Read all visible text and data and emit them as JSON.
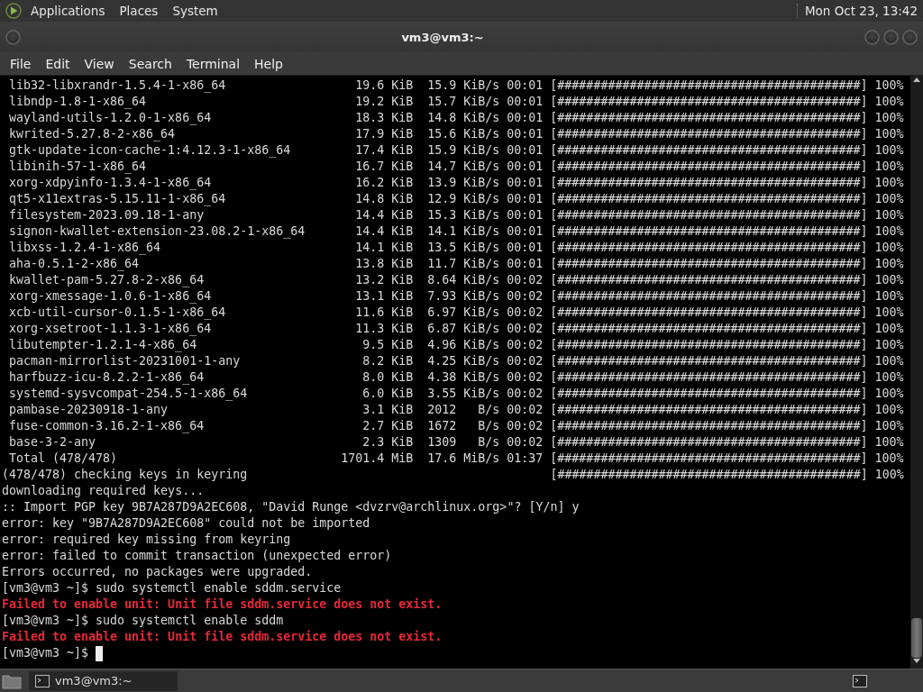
{
  "top_panel": {
    "menus": [
      "Applications",
      "Places",
      "System"
    ],
    "clock": "Mon Oct 23, 13:42"
  },
  "window": {
    "title": "vm3@vm3:~",
    "menu": [
      "File",
      "Edit",
      "View",
      "Search",
      "Terminal",
      "Help"
    ]
  },
  "terminal": {
    "lines": [
      {
        "kind": "transfer",
        "name": "lib32-libxrandr-1.5.4-1-x86_64",
        "size": "19.6 KiB",
        "rate": "15.9 KiB/s",
        "eta": "00:01",
        "bar": "[##########################################]",
        "percent": "100%"
      },
      {
        "kind": "transfer",
        "name": "libndp-1.8-1-x86_64",
        "size": "19.2 KiB",
        "rate": "15.7 KiB/s",
        "eta": "00:01",
        "bar": "[##########################################]",
        "percent": "100%"
      },
      {
        "kind": "transfer",
        "name": "wayland-utils-1.2.0-1-x86_64",
        "size": "18.3 KiB",
        "rate": "14.8 KiB/s",
        "eta": "00:01",
        "bar": "[##########################################]",
        "percent": "100%"
      },
      {
        "kind": "transfer",
        "name": "kwrited-5.27.8-2-x86_64",
        "size": "17.9 KiB",
        "rate": "15.6 KiB/s",
        "eta": "00:01",
        "bar": "[##########################################]",
        "percent": "100%"
      },
      {
        "kind": "transfer",
        "name": "gtk-update-icon-cache-1:4.12.3-1-x86_64",
        "size": "17.4 KiB",
        "rate": "15.9 KiB/s",
        "eta": "00:01",
        "bar": "[##########################################]",
        "percent": "100%"
      },
      {
        "kind": "transfer",
        "name": "libinih-57-1-x86_64",
        "size": "16.7 KiB",
        "rate": "14.7 KiB/s",
        "eta": "00:01",
        "bar": "[##########################################]",
        "percent": "100%"
      },
      {
        "kind": "transfer",
        "name": "xorg-xdpyinfo-1.3.4-1-x86_64",
        "size": "16.2 KiB",
        "rate": "13.9 KiB/s",
        "eta": "00:01",
        "bar": "[##########################################]",
        "percent": "100%"
      },
      {
        "kind": "transfer",
        "name": "qt5-x11extras-5.15.11-1-x86_64",
        "size": "14.8 KiB",
        "rate": "12.9 KiB/s",
        "eta": "00:01",
        "bar": "[##########################################]",
        "percent": "100%"
      },
      {
        "kind": "transfer",
        "name": "filesystem-2023.09.18-1-any",
        "size": "14.4 KiB",
        "rate": "15.3 KiB/s",
        "eta": "00:01",
        "bar": "[##########################################]",
        "percent": "100%"
      },
      {
        "kind": "transfer",
        "name": "signon-kwallet-extension-23.08.2-1-x86_64",
        "size": "14.4 KiB",
        "rate": "14.1 KiB/s",
        "eta": "00:01",
        "bar": "[##########################################]",
        "percent": "100%"
      },
      {
        "kind": "transfer",
        "name": "libxss-1.2.4-1-x86_64",
        "size": "14.1 KiB",
        "rate": "13.5 KiB/s",
        "eta": "00:01",
        "bar": "[##########################################]",
        "percent": "100%"
      },
      {
        "kind": "transfer",
        "name": "aha-0.5.1-2-x86_64",
        "size": "13.8 KiB",
        "rate": "11.7 KiB/s",
        "eta": "00:01",
        "bar": "[##########################################]",
        "percent": "100%"
      },
      {
        "kind": "transfer",
        "name": "kwallet-pam-5.27.8-2-x86_64",
        "size": "13.2 KiB",
        "rate": "8.64 KiB/s",
        "eta": "00:02",
        "bar": "[##########################################]",
        "percent": "100%"
      },
      {
        "kind": "transfer",
        "name": "xorg-xmessage-1.0.6-1-x86_64",
        "size": "13.1 KiB",
        "rate": "7.93 KiB/s",
        "eta": "00:02",
        "bar": "[##########################################]",
        "percent": "100%"
      },
      {
        "kind": "transfer",
        "name": "xcb-util-cursor-0.1.5-1-x86_64",
        "size": "11.6 KiB",
        "rate": "6.97 KiB/s",
        "eta": "00:02",
        "bar": "[##########################################]",
        "percent": "100%"
      },
      {
        "kind": "transfer",
        "name": "xorg-xsetroot-1.1.3-1-x86_64",
        "size": "11.3 KiB",
        "rate": "6.87 KiB/s",
        "eta": "00:02",
        "bar": "[##########################################]",
        "percent": "100%"
      },
      {
        "kind": "transfer",
        "name": "libutempter-1.2.1-4-x86_64",
        "size": "9.5 KiB",
        "rate": "4.96 KiB/s",
        "eta": "00:02",
        "bar": "[##########################################]",
        "percent": "100%"
      },
      {
        "kind": "transfer",
        "name": "pacman-mirrorlist-20231001-1-any",
        "size": "8.2 KiB",
        "rate": "4.25 KiB/s",
        "eta": "00:02",
        "bar": "[##########################################]",
        "percent": "100%"
      },
      {
        "kind": "transfer",
        "name": "harfbuzz-icu-8.2.2-1-x86_64",
        "size": "8.0 KiB",
        "rate": "4.38 KiB/s",
        "eta": "00:02",
        "bar": "[##########################################]",
        "percent": "100%"
      },
      {
        "kind": "transfer",
        "name": "systemd-sysvcompat-254.5-1-x86_64",
        "size": "6.0 KiB",
        "rate": "3.55 KiB/s",
        "eta": "00:02",
        "bar": "[##########################################]",
        "percent": "100%"
      },
      {
        "kind": "transfer",
        "name": "pambase-20230918-1-any",
        "size": "3.1 KiB",
        "rate": "2012   B/s",
        "eta": "00:02",
        "bar": "[##########################################]",
        "percent": "100%"
      },
      {
        "kind": "transfer",
        "name": "fuse-common-3.16.2-1-x86_64",
        "size": "2.7 KiB",
        "rate": "1672   B/s",
        "eta": "00:02",
        "bar": "[##########################################]",
        "percent": "100%"
      },
      {
        "kind": "transfer",
        "name": "base-3-2-any",
        "size": "2.3 KiB",
        "rate": "1309   B/s",
        "eta": "00:02",
        "bar": "[##########################################]",
        "percent": "100%"
      },
      {
        "kind": "transfer",
        "name": "Total (478/478)",
        "size": "1701.4 MiB",
        "rate": "17.6 MiB/s",
        "eta": "01:37",
        "bar": "[##########################################]",
        "percent": "100%"
      },
      {
        "kind": "check",
        "name": "(478/478) checking keys in keyring",
        "bar": "[##########################################]",
        "percent": "100%"
      },
      {
        "kind": "output",
        "text": "downloading required keys..."
      },
      {
        "kind": "output",
        "text": ":: Import PGP key 9B7A287D9A2EC608, \"David Runge <dvzrv@archlinux.org>\"? [Y/n] y"
      },
      {
        "kind": "output",
        "text": "error: key \"9B7A287D9A2EC608\" could not be imported"
      },
      {
        "kind": "output",
        "text": "error: required key missing from keyring"
      },
      {
        "kind": "output",
        "text": "error: failed to commit transaction (unexpected error)"
      },
      {
        "kind": "output",
        "text": "Errors occurred, no packages were upgraded."
      },
      {
        "kind": "output",
        "text": "[vm3@vm3 ~]$ sudo systemctl enable sddm.service"
      },
      {
        "kind": "error",
        "text": "Failed to enable unit: Unit file sddm.service does not exist."
      },
      {
        "kind": "output",
        "text": "[vm3@vm3 ~]$ sudo systemctl enable sddm"
      },
      {
        "kind": "error",
        "text": "Failed to enable unit: Unit file sddm.service does not exist."
      },
      {
        "kind": "prompt",
        "text": "[vm3@vm3 ~]$"
      }
    ]
  },
  "taskbar": {
    "items": [
      {
        "label": "vm3@vm3:~",
        "selected": true
      }
    ]
  }
}
